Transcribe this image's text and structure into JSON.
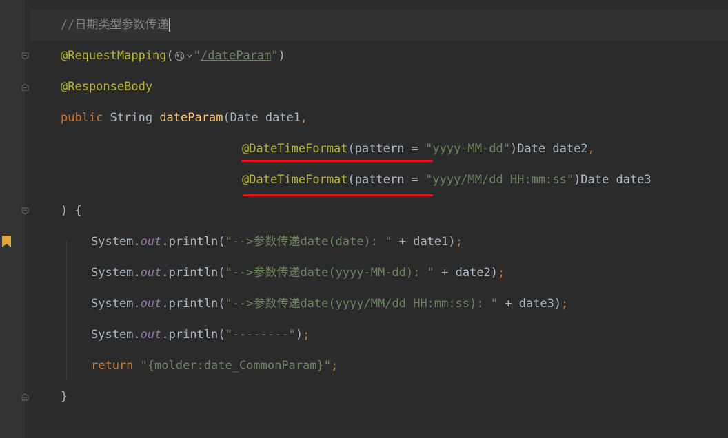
{
  "code": {
    "comment": "//日期类型参数传递",
    "request_mapping": {
      "annotation": "@RequestMapping",
      "open_paren": "(",
      "quote_open": "\"",
      "url": "/dateParam",
      "quote_close": "\"",
      "close_paren": ")"
    },
    "response_body": "@ResponseBody",
    "signature": {
      "keyword": "public",
      "type_and_space": " String ",
      "method_name": "dateParam",
      "params": "(Date date1",
      "comma": ","
    },
    "param2": {
      "annotation": "@DateTimeFormat",
      "open": "(pattern = ",
      "pattern": "\"yyyy-MM-dd\"",
      "rest": ")Date date2",
      "comma": ","
    },
    "param3": {
      "annotation": "@DateTimeFormat",
      "open": "(pattern = ",
      "pattern": "\"yyyy/MM/dd HH:mm:ss\"",
      "rest": ")Date date3"
    },
    "sig_close": ") {",
    "print1": {
      "prefix": "System.",
      "field": "out",
      "call": ".println(",
      "str": "\"-->参数传递date(date): \"",
      "rest": " + date1)",
      "semi": ";"
    },
    "print2": {
      "prefix": "System.",
      "field": "out",
      "call": ".println(",
      "str": "\"-->参数传递date(yyyy-MM-dd): \"",
      "rest": " + date2)",
      "semi": ";"
    },
    "print3": {
      "prefix": "System.",
      "field": "out",
      "call": ".println(",
      "str": "\"-->参数传递date(yyyy/MM/dd HH:mm:ss): \"",
      "rest": " + date3)",
      "semi": ";"
    },
    "print4": {
      "prefix": "System.",
      "field": "out",
      "call": ".println(",
      "str": "\"--------\"",
      "rest": ")",
      "semi": ";"
    },
    "return_stmt": {
      "keyword": "return",
      "str": " \"{molder:date_CommonParam}\"",
      "semi": ";"
    },
    "close_brace": "}"
  },
  "icons": {
    "globe": "globe-icon",
    "chevron": "chevron-down-icon",
    "bookmark": "bookmark-icon",
    "fold": "fold-marker-icon"
  },
  "colors": {
    "background": "#2b2b2b",
    "gutter": "#313335",
    "annotation": "#bbb529",
    "keyword": "#cc7832",
    "method": "#ffc66d",
    "string": "#6a8759",
    "field": "#9876aa",
    "comment": "#808080",
    "highlight_underline": "#e8141b",
    "bookmark": "#e2a73c"
  }
}
